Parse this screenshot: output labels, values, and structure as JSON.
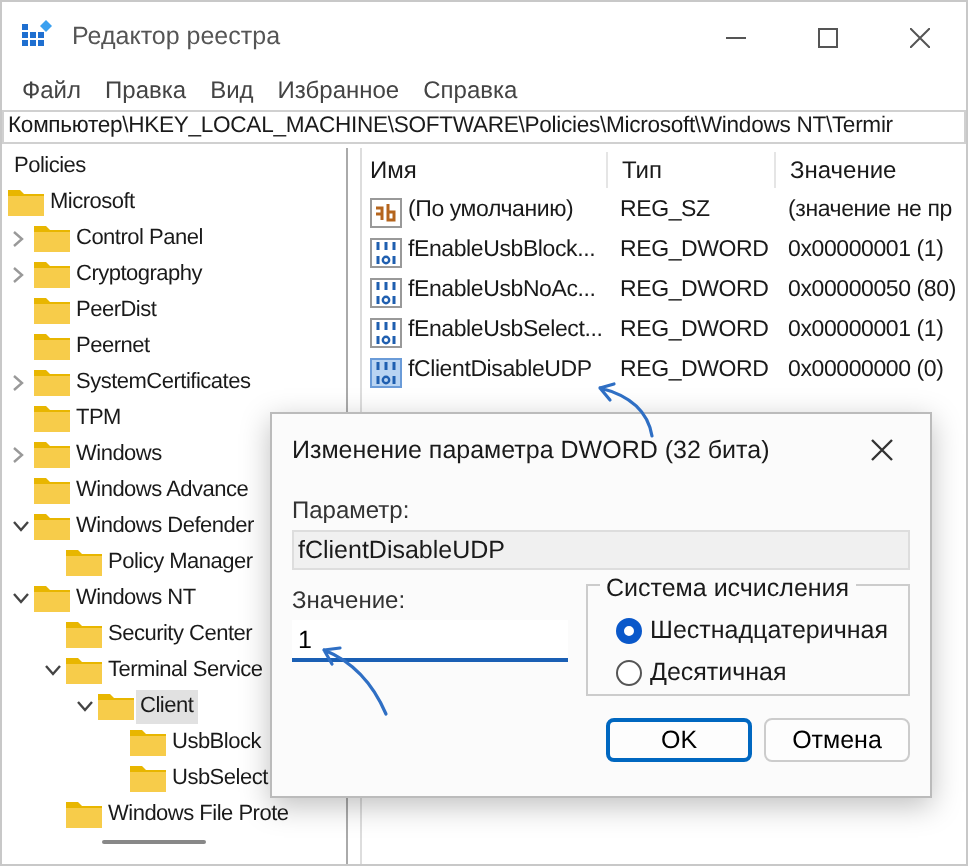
{
  "window": {
    "title": "Редактор реестра"
  },
  "menu": [
    "Файл",
    "Правка",
    "Вид",
    "Избранное",
    "Справка"
  ],
  "address": "Компьютер\\HKEY_LOCAL_MACHINE\\SOFTWARE\\Policies\\Microsoft\\Windows NT\\Termir",
  "tree": [
    {
      "label": "Policies",
      "selected": false,
      "children": [
        {
          "label": "Microsoft",
          "selected": false,
          "children": [
            {
              "label": "Control Panel",
              "expanded": false,
              "selected": false
            },
            {
              "label": "Cryptography",
              "expanded": false,
              "selected": false
            },
            {
              "label": "PeerDist",
              "selected": false
            },
            {
              "label": "Peernet",
              "selected": false
            },
            {
              "label": "SystemCertificates",
              "expanded": false,
              "selected": false
            },
            {
              "label": "TPM",
              "selected": false
            },
            {
              "label": "Windows",
              "expanded": false,
              "selected": false
            },
            {
              "label": "Windows Advance",
              "selected": false
            },
            {
              "label": "Windows Defender",
              "expanded": true,
              "selected": false,
              "children": [
                {
                  "label": "Policy Manager",
                  "selected": false
                }
              ]
            },
            {
              "label": "Windows NT",
              "expanded": true,
              "selected": false,
              "children": [
                {
                  "label": "Security Center",
                  "selected": false
                },
                {
                  "label": "Terminal Service",
                  "expanded": true,
                  "selected": false,
                  "children": [
                    {
                      "label": "Client",
                      "expanded": true,
                      "selected": true,
                      "children": [
                        {
                          "label": "UsbBlock",
                          "selected": false
                        },
                        {
                          "label": "UsbSelect",
                          "selected": false
                        }
                      ]
                    }
                  ]
                },
                {
                  "label": "Windows File Prote",
                  "selected": false
                }
              ]
            }
          ]
        }
      ]
    }
  ],
  "table": {
    "columns": [
      "Имя",
      "Тип",
      "Значение"
    ],
    "rows": [
      {
        "kind": "string",
        "selected": false,
        "cells": [
          "(По умолчанию)",
          "REG_SZ",
          "(значение не пр"
        ]
      },
      {
        "kind": "binary",
        "selected": false,
        "cells": [
          "fEnableUsbBlock...",
          "REG_DWORD",
          "0x00000001 (1)"
        ]
      },
      {
        "kind": "binary",
        "selected": false,
        "cells": [
          "fEnableUsbNoAc...",
          "REG_DWORD",
          "0x00000050 (80)"
        ]
      },
      {
        "kind": "binary",
        "selected": false,
        "cells": [
          "fEnableUsbSelect...",
          "REG_DWORD",
          "0x00000001 (1)"
        ]
      },
      {
        "kind": "binary",
        "selected": true,
        "cells": [
          "fClientDisableUDP",
          "REG_DWORD",
          "0x00000000 (0)"
        ]
      }
    ]
  },
  "dialog": {
    "title": "Изменение параметра DWORD (32 бита)",
    "name_label": "Параметр:",
    "name_value": "fClientDisableUDP",
    "value_label": "Значение:",
    "value": "1",
    "base_group": "Система исчисления",
    "base_options": [
      {
        "label": "Шестнадцатеричная",
        "selected": true
      },
      {
        "label": "Десятичная",
        "selected": false
      }
    ],
    "buttons": [
      {
        "label": "OK",
        "default": true
      },
      {
        "label": "Отмена",
        "default": false
      }
    ]
  }
}
